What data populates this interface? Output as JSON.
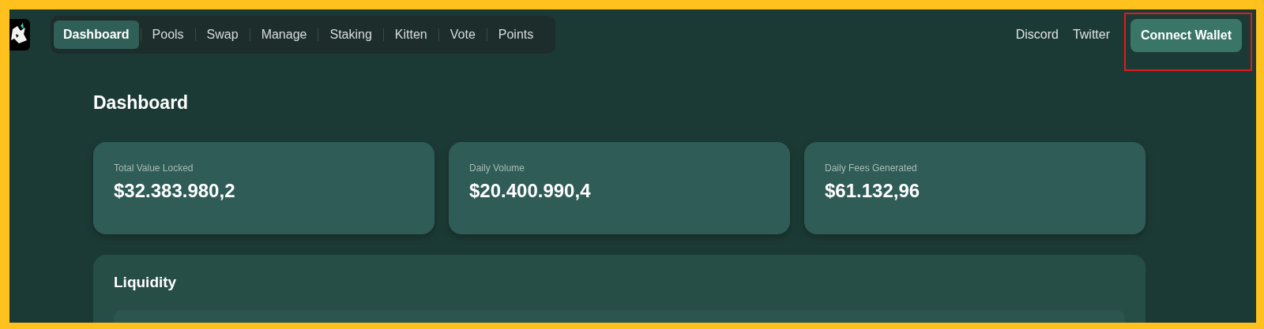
{
  "nav": {
    "tabs": [
      {
        "label": "Dashboard",
        "selected": true
      },
      {
        "label": "Pools",
        "selected": false
      },
      {
        "label": "Swap",
        "selected": false
      },
      {
        "label": "Manage",
        "selected": false
      },
      {
        "label": "Staking",
        "selected": false
      },
      {
        "label": "Kitten",
        "selected": false
      },
      {
        "label": "Vote",
        "selected": false
      },
      {
        "label": "Points",
        "selected": false
      }
    ],
    "links": [
      "Discord",
      "Twitter"
    ],
    "connect_button": {
      "label": "Connect Wallet",
      "highlighted": true
    }
  },
  "page_title": "Dashboard",
  "stats": [
    {
      "label": "Total Value Locked",
      "value": "$32.383.980,2"
    },
    {
      "label": "Daily Volume",
      "value": "$20.400.990,4"
    },
    {
      "label": "Daily Fees Generated",
      "value": "$61.132,96"
    }
  ],
  "liquidity": {
    "title": "Liquidity"
  }
}
